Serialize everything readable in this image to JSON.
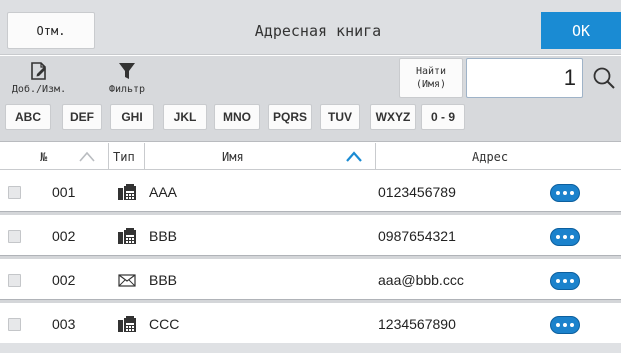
{
  "header": {
    "cancel_label": "Отм.",
    "title": "Адресная книга",
    "ok_label": "OK"
  },
  "toolbar": {
    "add_edit_label": "Доб./Изм.",
    "filter_label": "Фильтр",
    "find_label_line1": "Найти",
    "find_label_line2": "(Имя)",
    "search_value": "1",
    "letters": [
      "ABC",
      "DEF",
      "GHI",
      "JKL",
      "MNO",
      "PQRS",
      "TUV",
      "WXYZ",
      "0 - 9"
    ]
  },
  "columns": {
    "number": "№",
    "type": "Тип",
    "name": "Имя",
    "address": "Адрес"
  },
  "rows": [
    {
      "number": "001",
      "type_icon": "fax-icon",
      "name": "AAA",
      "address": "0123456789"
    },
    {
      "number": "002",
      "type_icon": "fax-icon",
      "name": "BBB",
      "address": "0987654321"
    },
    {
      "number": "002",
      "type_icon": "email-icon",
      "name": "BBB",
      "address": "aaa@bbb.ccc"
    },
    {
      "number": "003",
      "type_icon": "fax-icon",
      "name": "CCC",
      "address": "1234567890"
    }
  ],
  "colors": {
    "accent": "#1a8bd3",
    "more_button": "#1b82cc"
  }
}
